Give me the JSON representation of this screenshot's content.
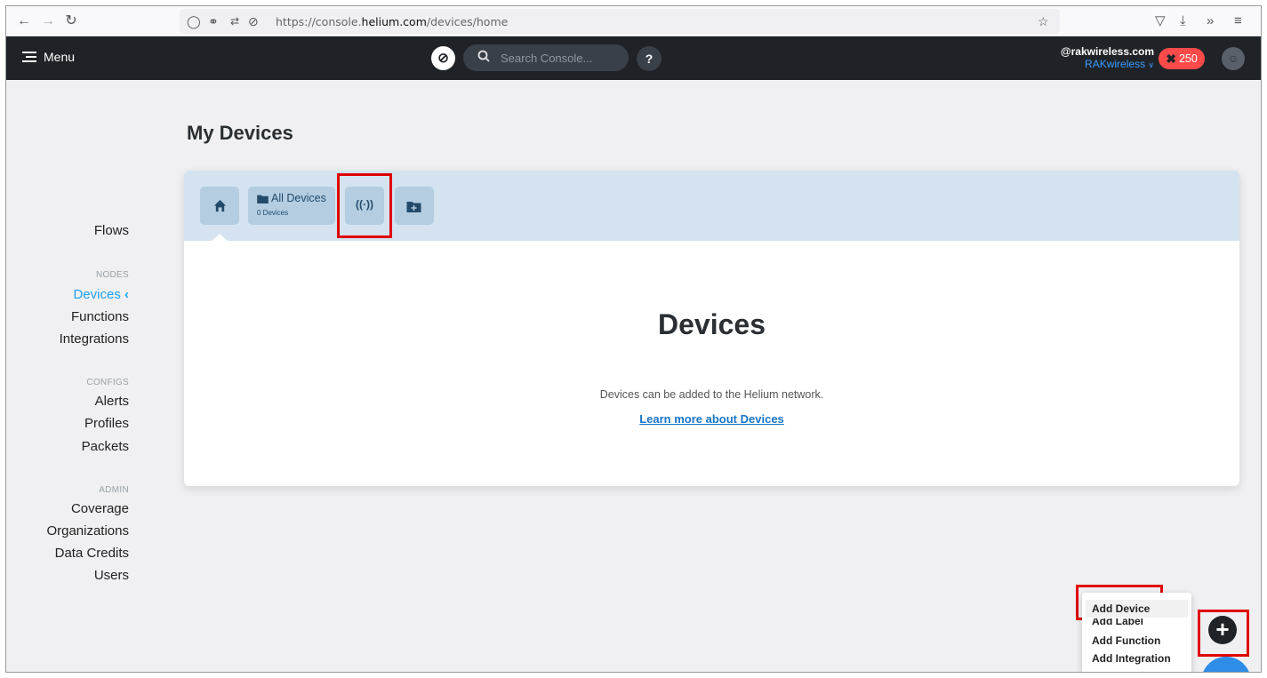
{
  "browser": {
    "url_prefix": "https://console.",
    "url_domain": "helium.com",
    "url_path": "/devices/home"
  },
  "header": {
    "menu_label": "Menu",
    "search_placeholder": "Search Console...",
    "help_label": "?",
    "account_email": "@rakwireless.com",
    "org_name": "RAKwireless",
    "data_credits": "250"
  },
  "sidebar": {
    "flows": "Flows",
    "nodes_heading": "NODES",
    "devices": "Devices",
    "functions": "Functions",
    "integrations": "Integrations",
    "configs_heading": "CONFIGS",
    "alerts": "Alerts",
    "profiles": "Profiles",
    "packets": "Packets",
    "admin_heading": "ADMIN",
    "coverage": "Coverage",
    "organizations": "Organizations",
    "data_credits": "Data Credits",
    "users": "Users"
  },
  "main": {
    "page_title": "My Devices",
    "tabs": {
      "all_devices_label": "All Devices",
      "all_devices_count": "0 Devices"
    },
    "heading": "Devices",
    "description": "Devices can be added to the Helium network.",
    "learn_more": "Learn more about Devices"
  },
  "popup_menu": {
    "items": [
      "Add Device",
      "Add Label",
      "Add Function",
      "Add Integration"
    ]
  },
  "colors": {
    "header_bg": "#1f2328",
    "active_blue": "#1ea0f5",
    "highlight_red": "#e00000",
    "badge_red": "#ff4a4a"
  }
}
